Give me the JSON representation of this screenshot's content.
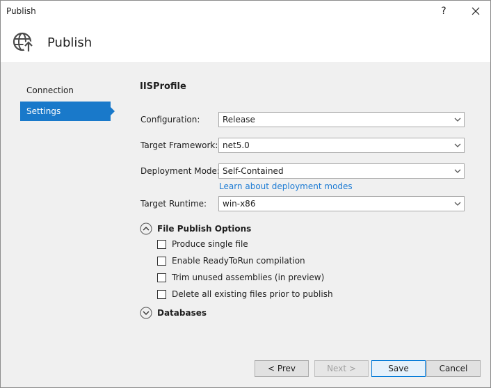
{
  "window": {
    "title": "Publish",
    "help_label": "?"
  },
  "header": {
    "title": "Publish",
    "icon": "globe-publish-icon"
  },
  "sidebar": {
    "items": [
      {
        "label": "Connection",
        "active": false
      },
      {
        "label": "Settings",
        "active": true
      }
    ]
  },
  "main": {
    "profile_name": "IISProfile",
    "fields": {
      "configuration": {
        "label": "Configuration:",
        "value": "Release"
      },
      "target_framework": {
        "label": "Target Framework:",
        "value": "net5.0"
      },
      "deployment_mode": {
        "label": "Deployment Mode:",
        "value": "Self-Contained"
      },
      "target_runtime": {
        "label": "Target Runtime:",
        "value": "win-x86"
      }
    },
    "learn_link": "Learn about deployment modes",
    "file_publish_options": {
      "title": "File Publish Options",
      "expanded": true,
      "options": [
        {
          "label": "Produce single file",
          "checked": false
        },
        {
          "label": "Enable ReadyToRun compilation",
          "checked": false
        },
        {
          "label": "Trim unused assemblies (in preview)",
          "checked": false
        },
        {
          "label": "Delete all existing files prior to publish",
          "checked": false
        }
      ]
    },
    "databases": {
      "title": "Databases",
      "expanded": false
    }
  },
  "footer": {
    "prev_label": "< Prev",
    "next_label": "Next >",
    "save_label": "Save",
    "cancel_label": "Cancel"
  },
  "colors": {
    "accent": "#1979ca",
    "link": "#1c7bd4",
    "background": "#f0f0f0"
  }
}
